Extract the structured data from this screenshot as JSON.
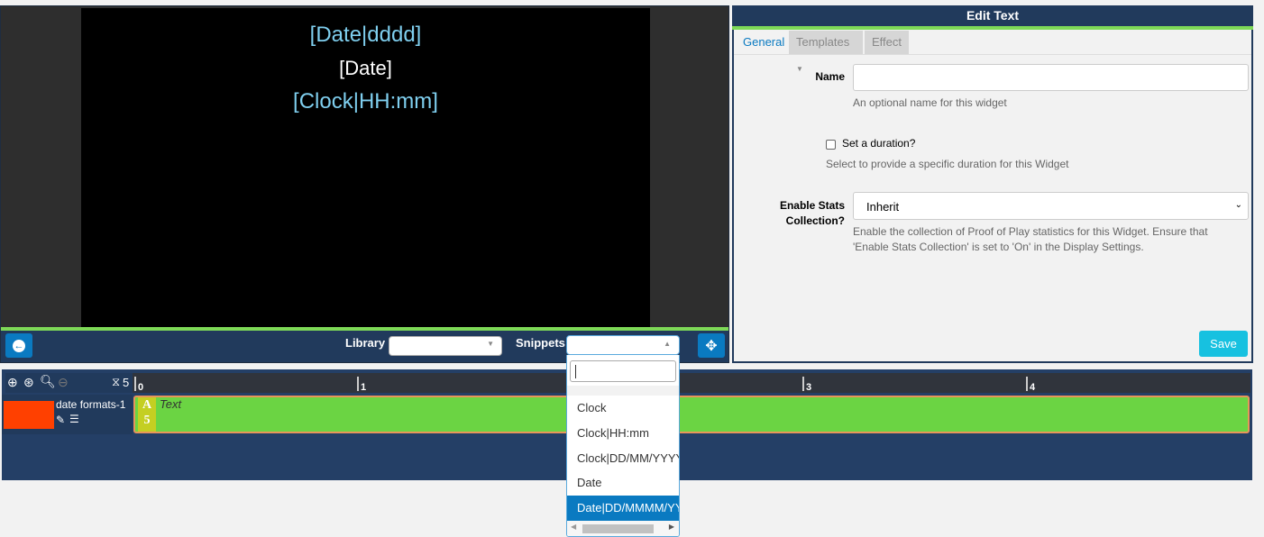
{
  "preview": {
    "lines": [
      {
        "text": "[Date|dddd]",
        "color": "#7fcfef"
      },
      {
        "text": "[Date]",
        "color": "#ffffff"
      },
      {
        "text": "[Clock|HH:mm]",
        "color": "#7fcfef"
      }
    ]
  },
  "toolbar": {
    "library_label": "Library",
    "snippets_label": "Snippets",
    "library_value": "",
    "snippets_value": ""
  },
  "editor": {
    "title": "Edit Text",
    "tabs": [
      {
        "label": "General",
        "active": true
      },
      {
        "label": "Templates"
      },
      {
        "label": "Effect"
      }
    ],
    "name_label": "Name",
    "name_value": "",
    "name_help": "An optional name for this widget",
    "duration_label": "Set a duration?",
    "duration_checked": false,
    "duration_help": "Select to provide a specific duration for this Widget",
    "stats_label_1": "Enable Stats",
    "stats_label_2": "Collection?",
    "stats_value": "Inherit",
    "stats_help_1": "Enable the collection of Proof of Play statistics for this Widget. Ensure that",
    "stats_help_2": "'Enable Stats Collection' is set to 'On' in the Display Settings.",
    "save_label": "Save"
  },
  "timeline": {
    "duration": "5",
    "ticks": [
      "0",
      "1",
      "3",
      "4"
    ],
    "region_name": "date formats-1",
    "region_color": "#ff4000",
    "widget": {
      "type_letter": "A",
      "duration": "5",
      "label": "Text",
      "color": "#6bd443"
    }
  },
  "snippets_dropdown": {
    "search_value": "",
    "options": [
      "Clock",
      "Clock|HH:mm",
      "Clock|DD/MM/YYYY",
      "Date",
      "Date|DD/MMMM/YYYY"
    ],
    "highlighted": "Date|DD/MMMM/YYYY"
  },
  "colors": {
    "navy": "#213a5c",
    "accent": "#0a7ac1",
    "save": "#17c1e0",
    "green": "#7ed957"
  }
}
